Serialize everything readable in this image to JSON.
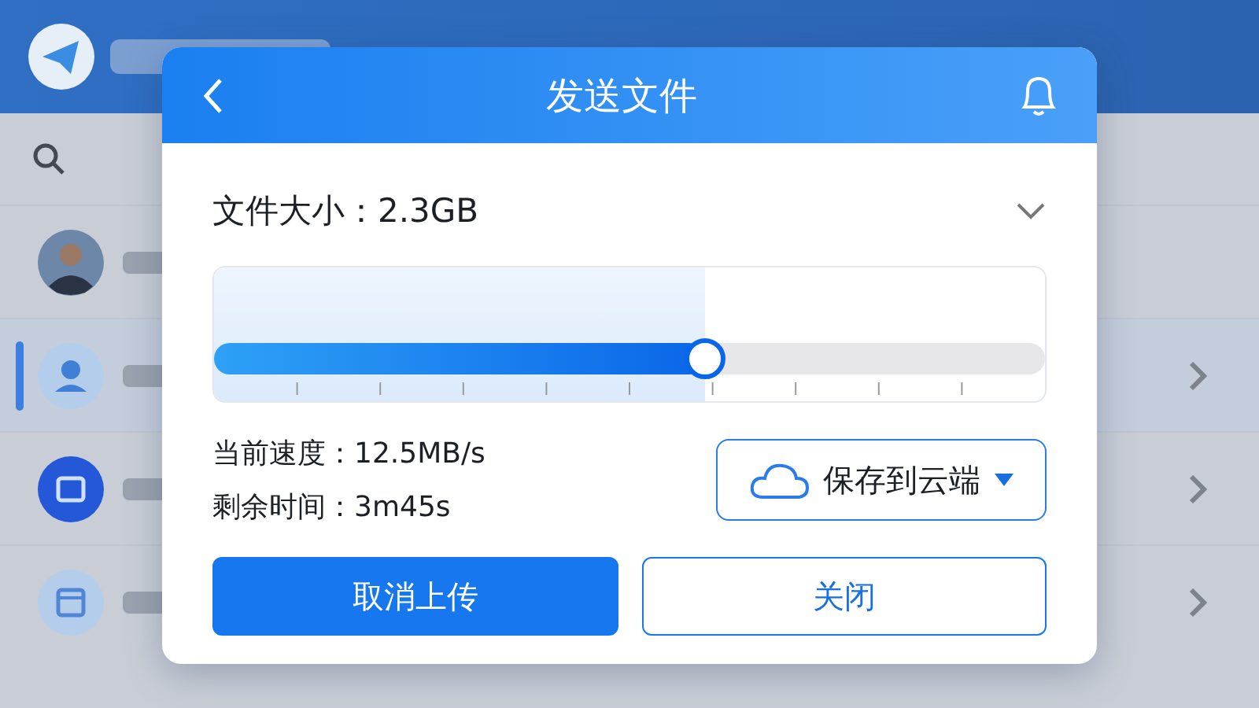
{
  "chat_list": [
    {
      "kind": "photo",
      "selected": false
    },
    {
      "kind": "person",
      "selected": true
    },
    {
      "kind": "bag",
      "selected": false
    },
    {
      "kind": "calendar",
      "selected": false
    }
  ],
  "dialog": {
    "title": "发送文件",
    "file_size_label": "文件大小：2.3GB",
    "progress": {
      "level": 0.59
    },
    "speed": "当前速度：12.5MB/s",
    "remaining": "剩余时间：3m45s",
    "destination": "保存到云端",
    "buttons": [
      {
        "label": "取消上传",
        "kind": "primary"
      },
      {
        "label": "关闭",
        "kind": "secondary"
      }
    ]
  }
}
